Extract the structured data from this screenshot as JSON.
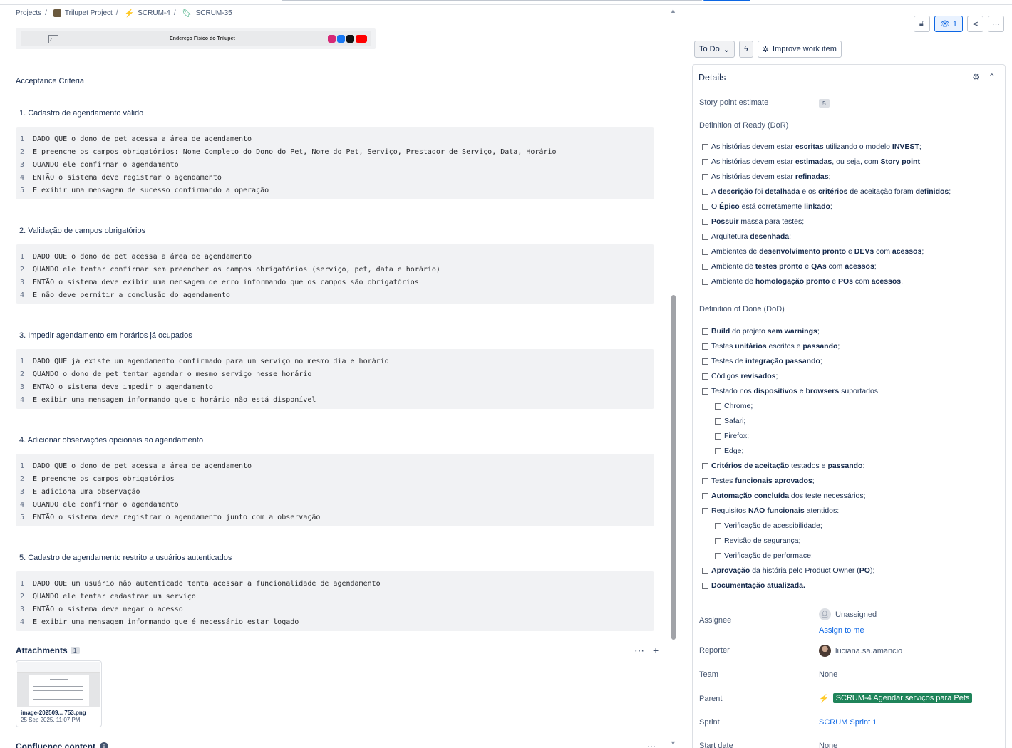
{
  "breadcrumb": {
    "projects": "Projects",
    "project": "Trilupet Project",
    "epic": "SCRUM-4",
    "story": "SCRUM-35"
  },
  "image_strip": {
    "title": "Endereço Físico do Trilupet"
  },
  "acceptance_title": "Acceptance Criteria",
  "scenarios": [
    {
      "title": "1. Cadastro de agendamento válido",
      "lines": [
        "DADO QUE o dono de pet acessa a área de agendamento",
        "E preenche os campos obrigatórios: Nome Completo do Dono do Pet, Nome do Pet, Serviço, Prestador de Serviço, Data, Horário",
        "QUANDO ele confirmar o agendamento",
        "ENTÃO o sistema deve registrar o agendamento",
        "E exibir uma mensagem de sucesso confirmando a operação"
      ]
    },
    {
      "title": "2. Validação de campos obrigatórios",
      "lines": [
        "DADO QUE o dono de pet acessa a área de agendamento",
        "QUANDO ele tentar confirmar sem preencher os campos obrigatórios (serviço, pet, data e horário)",
        "ENTÃO o sistema deve exibir uma mensagem de erro informando que os campos são obrigatórios",
        "E não deve permitir a conclusão do agendamento"
      ]
    },
    {
      "title": "3. Impedir agendamento em horários já ocupados",
      "lines": [
        "DADO QUE já existe um agendamento confirmado para um serviço no mesmo dia e horário",
        "QUANDO o dono de pet tentar agendar o mesmo serviço nesse horário",
        "ENTÃO o sistema deve impedir o agendamento",
        "E exibir uma mensagem informando que o horário não está disponível"
      ]
    },
    {
      "title": "4. Adicionar observações opcionais ao agendamento",
      "lines": [
        "DADO QUE o dono de pet acessa a área de agendamento",
        "E preenche os campos obrigatórios",
        "E adiciona uma observação",
        "QUANDO ele confirmar o agendamento",
        "ENTÃO o sistema deve registrar o agendamento junto com a observação"
      ]
    },
    {
      "title": "5. Cadastro de agendamento restrito a usuários autenticados",
      "lines": [
        "DADO QUE um usuário não autenticado tenta acessar a funcionalidade de agendamento",
        "QUANDO ele tentar cadastrar um serviço",
        "ENTÃO o sistema deve negar o acesso",
        "E exibir uma mensagem informando que é necessário estar logado"
      ]
    }
  ],
  "attachments": {
    "title": "Attachments",
    "count": "1",
    "file_name": "image-202509... 753.png",
    "file_date": "25 Sep 2025, 11:07 PM"
  },
  "confluence": {
    "title": "Confluence content"
  },
  "actions": {
    "watch_count": "1",
    "status": "To Do",
    "improve": "Improve work item"
  },
  "details": {
    "title": "Details",
    "story_point_label": "Story point estimate",
    "story_point_value": "5",
    "dor_label": "Definition of Ready (DoR)",
    "dod_label": "Definition of Done (DoD)",
    "assignee_label": "Assignee",
    "assignee_value": "Unassigned",
    "assign_to_me": "Assign to me",
    "reporter_label": "Reporter",
    "reporter_value": "luciana.sa.amancio",
    "team_label": "Team",
    "team_value": "None",
    "parent_label": "Parent",
    "parent_value": "SCRUM-4 Agendar serviços para Pets",
    "sprint_label": "Sprint",
    "sprint_value": "SCRUM Sprint 1",
    "start_label": "Start date",
    "start_value": "None"
  },
  "dor_items": [
    {
      "indent": 0,
      "parts": [
        [
          "As histórias devem estar ",
          0
        ],
        [
          "escritas",
          1
        ],
        [
          " utilizando o modelo ",
          0
        ],
        [
          "INVEST",
          1
        ],
        [
          ";",
          0
        ]
      ]
    },
    {
      "indent": 0,
      "parts": [
        [
          "As histórias devem estar ",
          0
        ],
        [
          "estimadas",
          1
        ],
        [
          ", ou seja, com ",
          0
        ],
        [
          "Story point",
          1
        ],
        [
          ";",
          0
        ]
      ]
    },
    {
      "indent": 0,
      "parts": [
        [
          "As histórias devem estar ",
          0
        ],
        [
          "refinadas",
          1
        ],
        [
          ";",
          0
        ]
      ]
    },
    {
      "indent": 0,
      "parts": [
        [
          "A ",
          0
        ],
        [
          "descrição",
          1
        ],
        [
          " foi ",
          0
        ],
        [
          "detalhada",
          1
        ],
        [
          " e os ",
          0
        ],
        [
          "critérios",
          1
        ],
        [
          " de aceitação foram ",
          0
        ],
        [
          "definidos",
          1
        ],
        [
          ";",
          0
        ]
      ]
    },
    {
      "indent": 0,
      "parts": [
        [
          "O ",
          0
        ],
        [
          "Épico",
          1
        ],
        [
          " está corretamente ",
          0
        ],
        [
          "linkado",
          1
        ],
        [
          ";",
          0
        ]
      ]
    },
    {
      "indent": 0,
      "parts": [
        [
          "Possuir",
          1
        ],
        [
          " massa para testes;",
          0
        ]
      ]
    },
    {
      "indent": 0,
      "parts": [
        [
          "Arquitetura ",
          0
        ],
        [
          "desenhada",
          1
        ],
        [
          ";",
          0
        ]
      ]
    },
    {
      "indent": 0,
      "parts": [
        [
          "Ambientes de ",
          0
        ],
        [
          "desenvolvimento pronto",
          1
        ],
        [
          " e ",
          0
        ],
        [
          "DEVs",
          1
        ],
        [
          " com ",
          0
        ],
        [
          "acessos",
          1
        ],
        [
          ";",
          0
        ]
      ]
    },
    {
      "indent": 0,
      "parts": [
        [
          "Ambiente de ",
          0
        ],
        [
          "testes pronto",
          1
        ],
        [
          " e ",
          0
        ],
        [
          "QAs",
          1
        ],
        [
          " com ",
          0
        ],
        [
          "acessos",
          1
        ],
        [
          ";",
          0
        ]
      ]
    },
    {
      "indent": 0,
      "parts": [
        [
          "Ambiente de ",
          0
        ],
        [
          "homologação pronto",
          1
        ],
        [
          " e ",
          0
        ],
        [
          "POs",
          1
        ],
        [
          " com ",
          0
        ],
        [
          "acessos",
          1
        ],
        [
          ".",
          0
        ]
      ]
    }
  ],
  "dod_items": [
    {
      "indent": 0,
      "parts": [
        [
          "Build",
          1
        ],
        [
          " do projeto ",
          0
        ],
        [
          "sem warnings",
          1
        ],
        [
          ";",
          0
        ]
      ]
    },
    {
      "indent": 0,
      "parts": [
        [
          "Testes ",
          0
        ],
        [
          "unitários",
          1
        ],
        [
          " escritos e ",
          0
        ],
        [
          "passando",
          1
        ],
        [
          ";",
          0
        ]
      ]
    },
    {
      "indent": 0,
      "parts": [
        [
          "Testes de ",
          0
        ],
        [
          "integração passando",
          1
        ],
        [
          ";",
          0
        ]
      ]
    },
    {
      "indent": 0,
      "parts": [
        [
          "Códigos ",
          0
        ],
        [
          "revisados",
          1
        ],
        [
          ";",
          0
        ]
      ]
    },
    {
      "indent": 0,
      "parts": [
        [
          "Testado nos ",
          0
        ],
        [
          "dispositivos",
          1
        ],
        [
          " e ",
          0
        ],
        [
          "browsers",
          1
        ],
        [
          " suportados:",
          0
        ]
      ]
    },
    {
      "indent": 1,
      "parts": [
        [
          "Chrome;",
          0
        ]
      ]
    },
    {
      "indent": 1,
      "parts": [
        [
          "Safari;",
          0
        ]
      ]
    },
    {
      "indent": 1,
      "parts": [
        [
          "Firefox;",
          0
        ]
      ]
    },
    {
      "indent": 1,
      "parts": [
        [
          "Edge;",
          0
        ]
      ]
    },
    {
      "indent": 0,
      "parts": [
        [
          "Critérios de aceitação",
          1
        ],
        [
          " testados e ",
          0
        ],
        [
          "passando;",
          1
        ]
      ]
    },
    {
      "indent": 0,
      "parts": [
        [
          "Testes ",
          0
        ],
        [
          "funcionais aprovados",
          1
        ],
        [
          ";",
          0
        ]
      ]
    },
    {
      "indent": 0,
      "parts": [
        [
          "Automação concluída",
          1
        ],
        [
          " dos teste necessários;",
          0
        ]
      ]
    },
    {
      "indent": 0,
      "parts": [
        [
          "Requisitos ",
          0
        ],
        [
          "NÃO funcionais",
          1
        ],
        [
          " atentidos:",
          0
        ]
      ]
    },
    {
      "indent": 1,
      "parts": [
        [
          "Verificação de acessibilidade;",
          0
        ]
      ]
    },
    {
      "indent": 1,
      "parts": [
        [
          "Revisão de segurança;",
          0
        ]
      ]
    },
    {
      "indent": 1,
      "parts": [
        [
          "Verificação de performace;",
          0
        ]
      ]
    },
    {
      "indent": 0,
      "parts": [
        [
          "Aprovação",
          1
        ],
        [
          " da história pelo Product Owner (",
          0
        ],
        [
          "PO",
          1
        ],
        [
          ");",
          0
        ]
      ]
    },
    {
      "indent": 0,
      "parts": [
        [
          "Documentação atualizada.",
          1
        ]
      ]
    }
  ]
}
